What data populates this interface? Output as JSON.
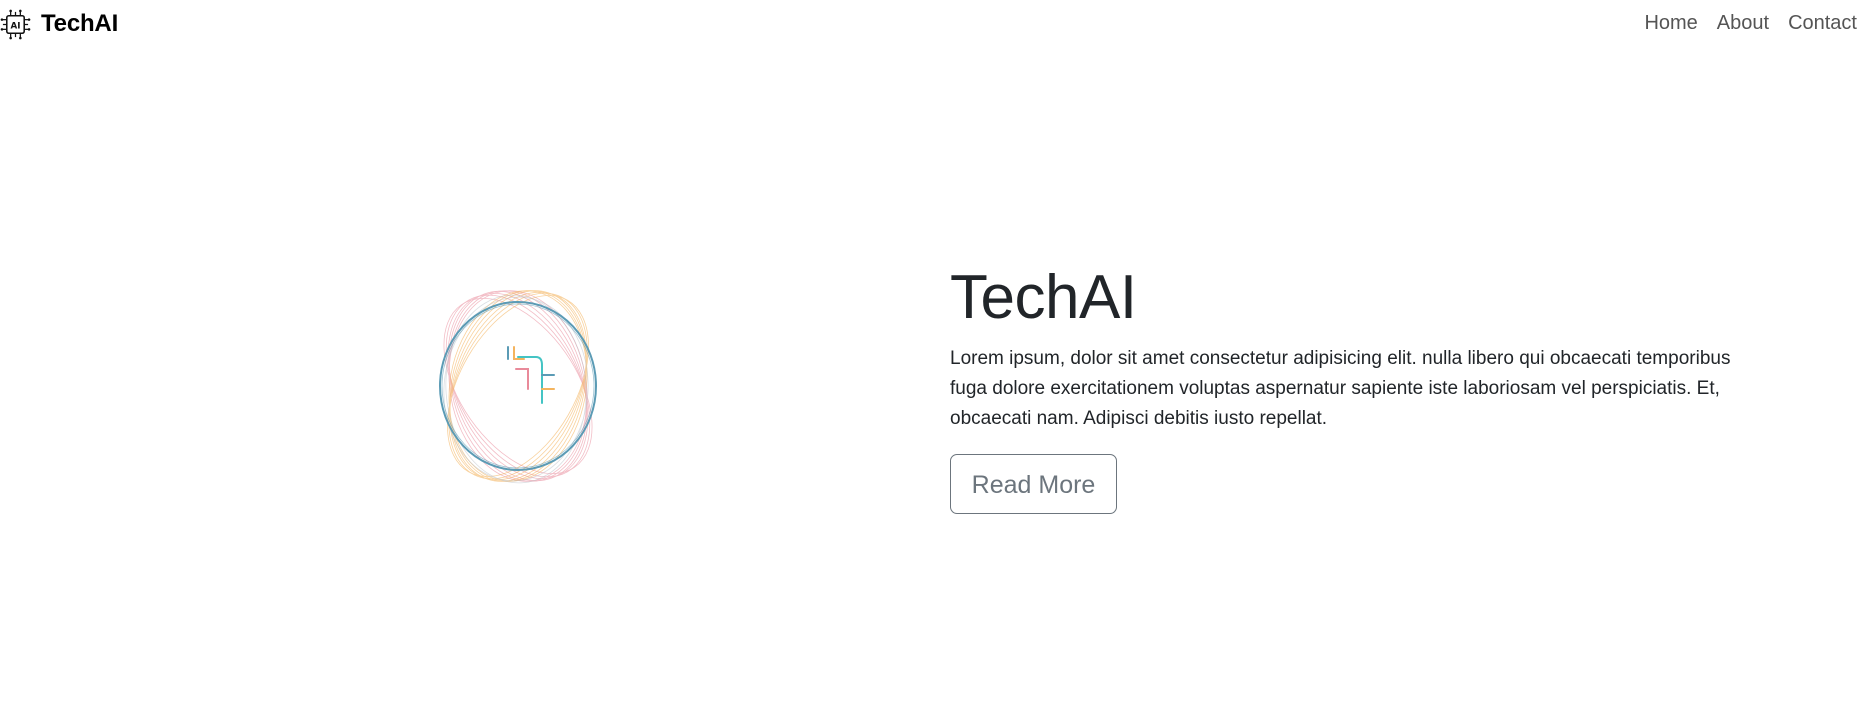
{
  "navbar": {
    "logo_icon": "ai-chip-icon",
    "brand": "TechAI",
    "links": [
      {
        "label": "Home"
      },
      {
        "label": "About"
      },
      {
        "label": "Contact"
      }
    ]
  },
  "hero": {
    "image_icon": "ai-swirl-ring-illustration",
    "title": "TechAI",
    "body": "Lorem ipsum, dolor sit amet consectetur adipisicing elit. nulla libero qui obcaecati temporibus fuga dolore exercitationem voluptas aspernatur sapiente iste laboriosam vel perspiciatis. Et, obcaecati nam. Adipisci debitis iusto repellat.",
    "button_label": "Read More"
  },
  "colors": {
    "text": "#212529",
    "nav_link": "#555555",
    "button_outline": "#6c757d",
    "ring_blue": "#5b9bb5",
    "ring_pink": "#e98a9a",
    "ring_orange": "#f4b45e",
    "ring_teal": "#44c4c4"
  }
}
